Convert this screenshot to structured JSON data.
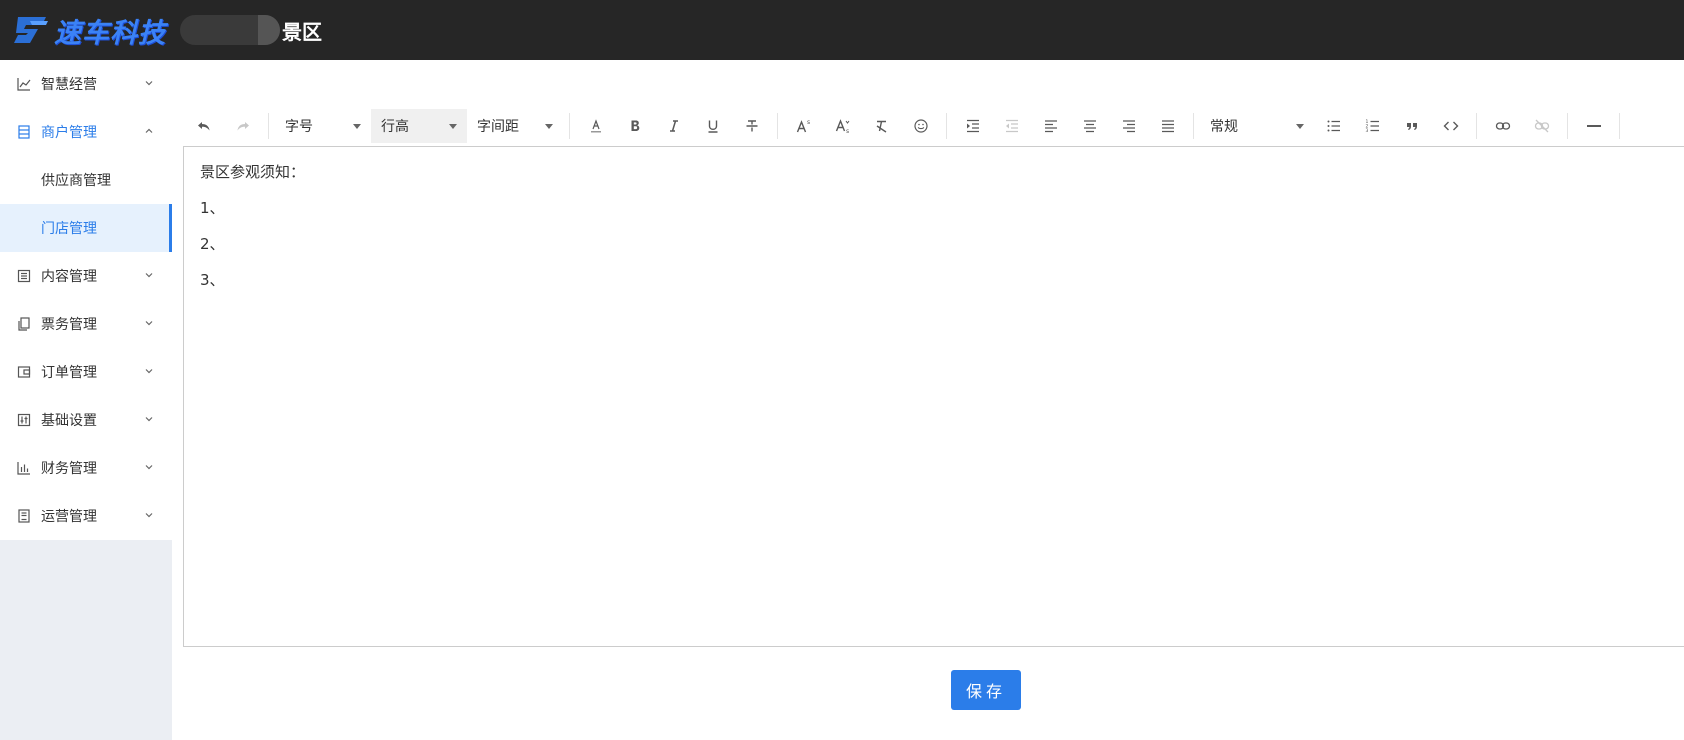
{
  "header": {
    "logo_text": "速车科技",
    "site_name": "景区"
  },
  "sidebar": {
    "items": [
      {
        "label": "智慧经营",
        "icon": "chart-line-icon",
        "expanded": false
      },
      {
        "label": "商户管理",
        "icon": "document-icon",
        "expanded": true,
        "active": true,
        "children": [
          {
            "label": "供应商管理",
            "selected": false
          },
          {
            "label": "门店管理",
            "selected": true
          }
        ]
      },
      {
        "label": "内容管理",
        "icon": "list-icon",
        "expanded": false
      },
      {
        "label": "票务管理",
        "icon": "ticket-icon",
        "expanded": false
      },
      {
        "label": "订单管理",
        "icon": "wallet-icon",
        "expanded": false
      },
      {
        "label": "基础设置",
        "icon": "sliders-icon",
        "expanded": false
      },
      {
        "label": "财务管理",
        "icon": "bar-chart-icon",
        "expanded": false
      },
      {
        "label": "运营管理",
        "icon": "clipboard-icon",
        "expanded": false
      }
    ]
  },
  "toolbar": {
    "font_size_label": "字号",
    "line_height_label": "行高",
    "letter_spacing_label": "字间距",
    "paragraph_label": "常规"
  },
  "editor": {
    "lines": [
      "景区参观须知：",
      "1、",
      "2、",
      "3、"
    ]
  },
  "actions": {
    "save_label": "保存"
  },
  "colors": {
    "topbar": "#262626",
    "accent": "#2b7de9",
    "sidebar_bg": "#ebeef3",
    "selected_bg": "#e6f1fd"
  }
}
